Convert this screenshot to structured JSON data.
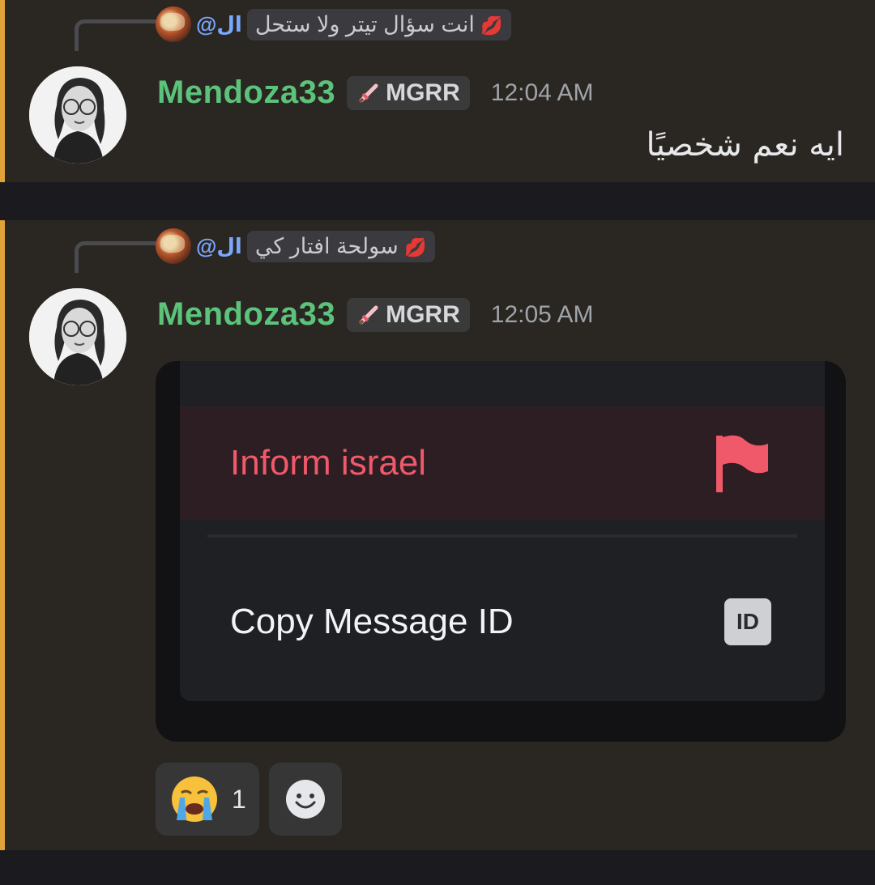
{
  "messages": [
    {
      "reply": {
        "mention": "@ال",
        "text": "انت سؤال تيتر ولا ستحل",
        "emoji": "💋"
      },
      "author": "Mendoza33",
      "tag": "MGRR",
      "tag_icon": "sword-icon",
      "time": "12:04 AM",
      "content": "ايه نعم شخصيًا"
    },
    {
      "reply": {
        "mention": "@ال",
        "text": "سولحة افتار كي",
        "emoji": "💋"
      },
      "author": "Mendoza33",
      "tag": "MGRR",
      "tag_icon": "sword-icon",
      "time": "12:05 AM",
      "attachment": {
        "menu_items": [
          {
            "label": "Inform israel",
            "icon": "flag-icon",
            "color": "#f0596a"
          },
          {
            "label": "Copy Message ID",
            "icon": "id-badge-icon",
            "badge_text": "ID"
          }
        ]
      },
      "reactions": [
        {
          "emoji": "😭",
          "count": "1"
        }
      ]
    }
  ],
  "colors": {
    "username": "#5cc37a",
    "accent_bar": "#e0a33a",
    "mention": "#7aa7ff",
    "background": "#2a2723"
  }
}
